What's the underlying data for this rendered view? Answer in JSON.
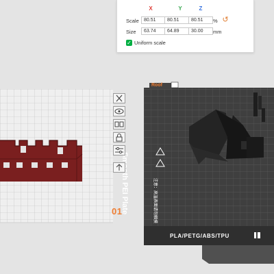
{
  "scale_panel": {
    "axes": [
      "X",
      "Y",
      "Z"
    ],
    "axis_colors": [
      "#e0403a",
      "#3aa852",
      "#3a74e0"
    ],
    "scale_label": "Scale",
    "size_label": "Size",
    "scale_values": [
      "80.51",
      "80.51",
      "80.51"
    ],
    "scale_unit": "%",
    "size_values": [
      "63.74",
      "64.89",
      "30.00"
    ],
    "size_unit": "mm",
    "reset_icon": "undo-icon",
    "uniform_scale_label": "Uniform scale",
    "uniform_scale_checked": true,
    "accent_color": "#00ae42"
  },
  "plate_tools": [
    {
      "name": "remove-plate-icon"
    },
    {
      "name": "auto-orient-icon"
    },
    {
      "name": "arrange-icon"
    },
    {
      "name": "lock-plate-icon"
    },
    {
      "name": "plate-settings-icon"
    },
    {
      "name": "move-plate-icon"
    }
  ],
  "plate": {
    "index": "01",
    "index_color": "#ef7d32",
    "name": "Smooth PEI Plate",
    "tag": "Roof",
    "materials": "PLA/PETG/ABS/TPU",
    "warning_text": "注意：高温表面请勿触摸"
  }
}
